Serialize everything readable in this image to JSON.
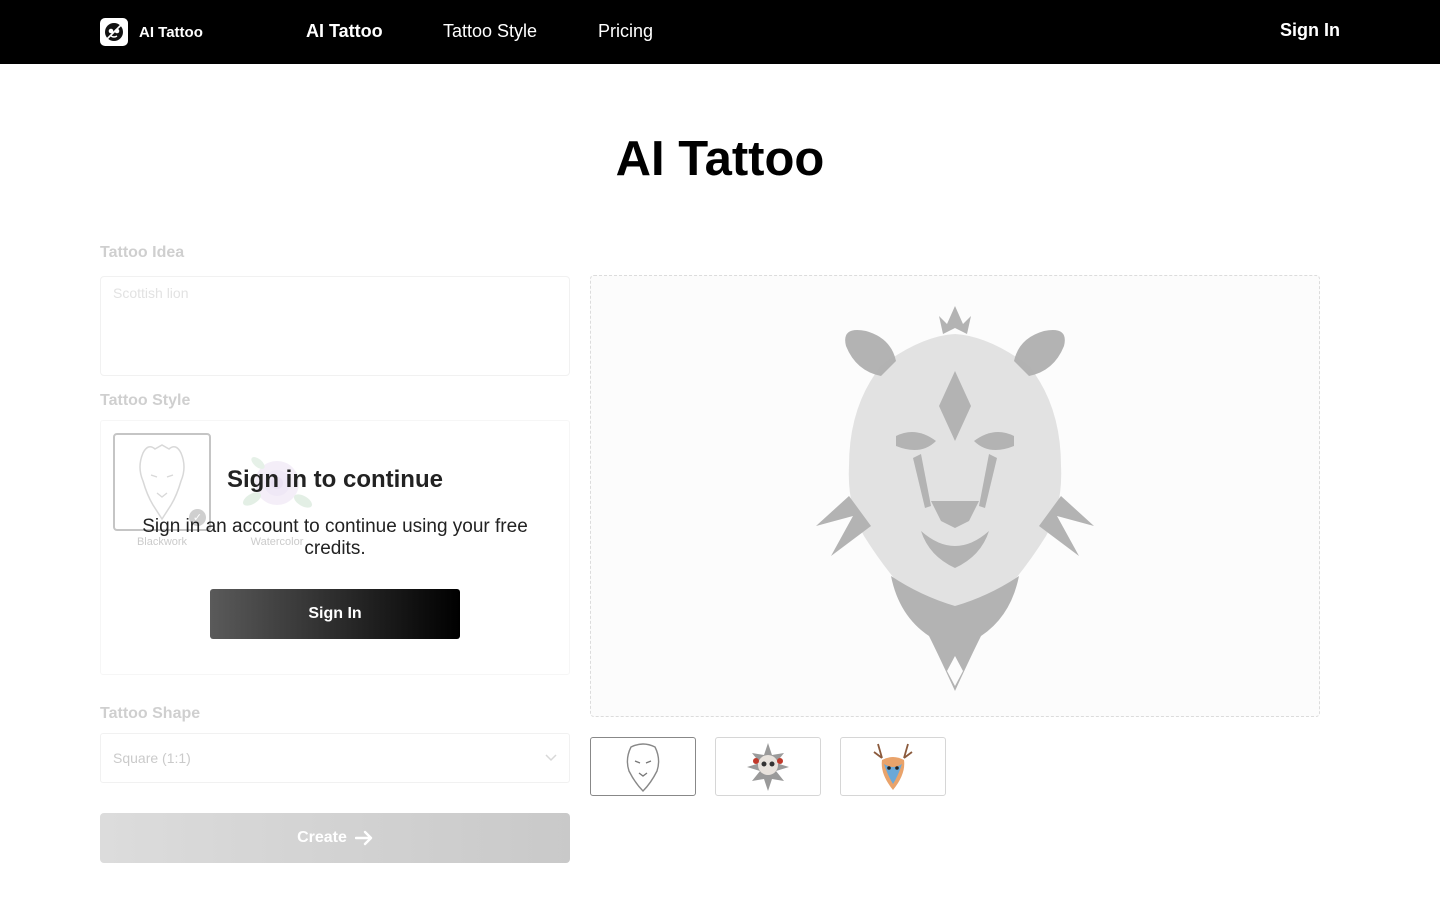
{
  "header": {
    "brand": "AI Tattoo",
    "nav": [
      "AI Tattoo",
      "Tattoo Style",
      "Pricing"
    ],
    "signin": "Sign In"
  },
  "page_title": "AI Tattoo",
  "form": {
    "idea_label": "Tattoo Idea",
    "idea_placeholder": "Scottish lion",
    "style_label": "Tattoo Style",
    "styles": [
      "Blackwork",
      "Watercolor"
    ],
    "shape_label": "Tattoo Shape",
    "shape_value": "Square (1:1)",
    "create_label": "Create"
  },
  "overlay": {
    "title": "Sign in to continue",
    "description": "Sign in an account to continue using your free credits.",
    "button": "Sign In"
  },
  "thumbnails": [
    "cheetah",
    "skull",
    "deer"
  ],
  "colors": {
    "header_bg": "#000000",
    "art_gray": "#b3b3b3"
  }
}
